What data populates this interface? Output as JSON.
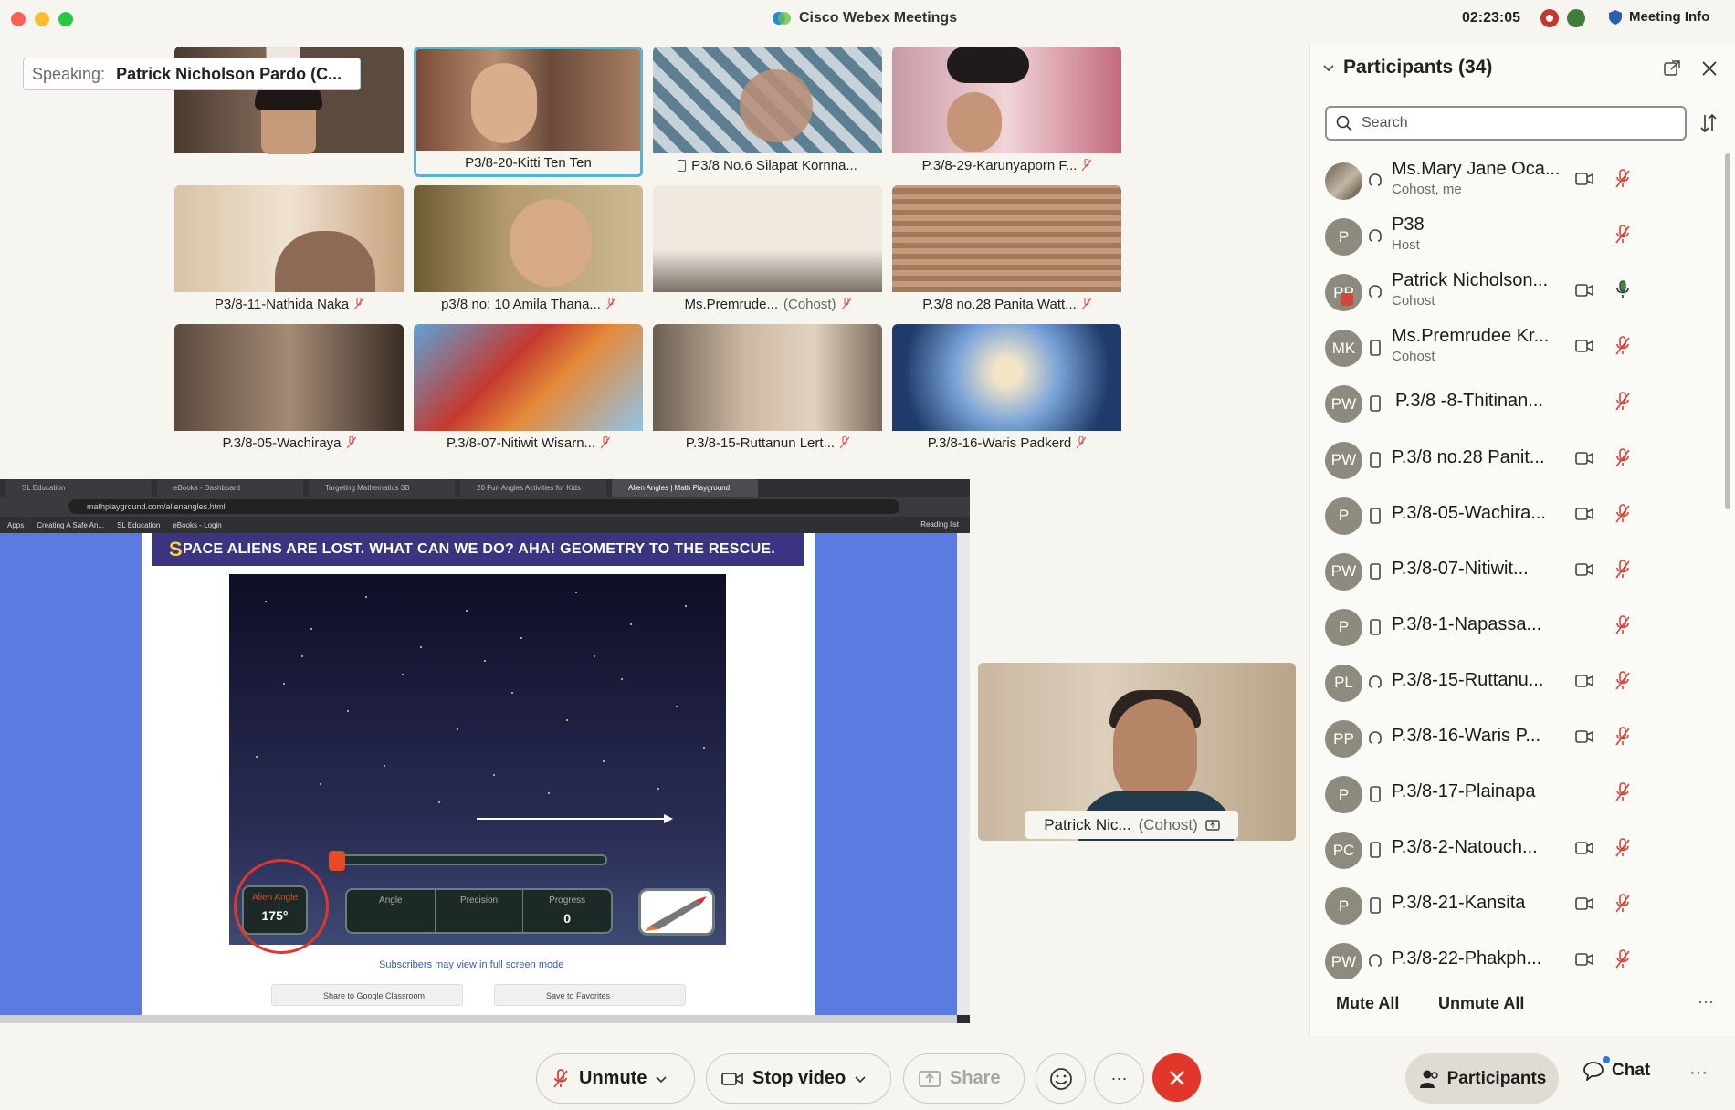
{
  "window": {
    "title": "Cisco Webex Meetings",
    "clock": "02:23:05",
    "meeting_info": "Meeting Info"
  },
  "speaking": {
    "label": "Speaking:",
    "name": "Patrick Nicholson Pardo (C..."
  },
  "gallery": [
    {
      "name": "",
      "sub": ""
    },
    {
      "name": "P3/8-20-Kitti Ten Ten",
      "sub": ""
    },
    {
      "name": "P3/8 No.6 Silapat Kornna...",
      "sub": ""
    },
    {
      "name": "P.3/8-29-Karunyaporn F...",
      "sub": ""
    },
    {
      "name": "P3/8-11-Nathida Naka",
      "sub": ""
    },
    {
      "name": "p3/8 no: 10 Amila Thana...",
      "sub": ""
    },
    {
      "name": "Ms.Premrude...",
      "sub": "(Cohost)"
    },
    {
      "name": "P.3/8 no.28 Panita Watt...",
      "sub": ""
    },
    {
      "name": "P.3/8-05-Wachiraya",
      "sub": ""
    },
    {
      "name": "P.3/8-07-Nitiwit Wisarn...",
      "sub": ""
    },
    {
      "name": "P.3/8-15-Ruttanun Lert...",
      "sub": ""
    },
    {
      "name": "P.3/8-16-Waris Padkerd",
      "sub": ""
    }
  ],
  "browser": {
    "tabs": [
      "SL Education",
      "eBooks - Dashboard",
      "Targeting Mathematics 3B",
      "20 Fun Angles Activities for Kids",
      "Alien Angles | Math Playground"
    ],
    "url": "mathplayground.com/alienangles.html",
    "bookmarks": [
      "Apps",
      "Creating A Safe An...",
      "SL Education",
      "eBooks - Login"
    ],
    "reading_list": "Reading list"
  },
  "game": {
    "banner_first": "S",
    "banner_rest": "PACE ALIENS ARE LOST. WHAT CAN WE DO? AHA! GEOMETRY TO THE RESCUE.",
    "alien_angle_label": "Alien Angle",
    "alien_angle_value": "175°",
    "col_angle": "Angle",
    "col_precision": "Precision",
    "col_progress": "Progress",
    "progress_value": "0",
    "subscribers_note": "Subscribers may view in full screen mode",
    "share_classroom": "Share to Google Classroom",
    "save_favorites": "Save to Favorites"
  },
  "speaker_tile": {
    "name": "Patrick Nic...",
    "sub": "(Cohost)"
  },
  "participants": {
    "title": "Participants (34)",
    "search_placeholder": "Search",
    "list": [
      {
        "initials": "",
        "name": "Ms.Mary Jane Oca...",
        "role": "Cohost, me",
        "video": true,
        "mic": "muted"
      },
      {
        "initials": "P",
        "name": "P38",
        "role": "Host",
        "video": false,
        "mic": "muted"
      },
      {
        "initials": "PP",
        "name": "Patrick Nicholson...",
        "role": "Cohost",
        "video": true,
        "mic": "active"
      },
      {
        "initials": "MK",
        "name": "Ms.Premrudee Kr...",
        "role": "Cohost",
        "video": true,
        "mic": "muted"
      },
      {
        "initials": "PW",
        "name": "P.3/8 -8-Thitinan...",
        "role": "",
        "video": false,
        "mic": "muted"
      },
      {
        "initials": "PW",
        "name": "P.3/8 no.28 Panit...",
        "role": "",
        "video": true,
        "mic": "muted"
      },
      {
        "initials": "P",
        "name": "P.3/8-05-Wachira...",
        "role": "",
        "video": true,
        "mic": "muted"
      },
      {
        "initials": "PW",
        "name": "P.3/8-07-Nitiwit...",
        "role": "",
        "video": true,
        "mic": "muted"
      },
      {
        "initials": "P",
        "name": "P.3/8-1-Napassa...",
        "role": "",
        "video": false,
        "mic": "muted"
      },
      {
        "initials": "PL",
        "name": "P.3/8-15-Ruttanu...",
        "role": "",
        "video": true,
        "mic": "muted"
      },
      {
        "initials": "PP",
        "name": "P.3/8-16-Waris P...",
        "role": "",
        "video": true,
        "mic": "muted"
      },
      {
        "initials": "P",
        "name": "P.3/8-17-Plainapa",
        "role": "",
        "video": false,
        "mic": "muted"
      },
      {
        "initials": "PC",
        "name": "P.3/8-2-Natouch...",
        "role": "",
        "video": true,
        "mic": "muted"
      },
      {
        "initials": "P",
        "name": "P.3/8-21-Kansita",
        "role": "",
        "video": true,
        "mic": "muted"
      },
      {
        "initials": "PW",
        "name": "P.3/8-22-Phakph...",
        "role": "",
        "video": true,
        "mic": "muted"
      }
    ],
    "mute_all": "Mute All",
    "unmute_all": "Unmute All"
  },
  "controls": {
    "unmute": "Unmute",
    "stop_video": "Stop video",
    "share": "Share",
    "participants": "Participants",
    "chat": "Chat"
  },
  "colors": {
    "end_call": "#e2362b",
    "selected_tile_border": "#5db2d3",
    "muted_mic": "#d3453b",
    "active_mic": "#3f8a3b"
  }
}
